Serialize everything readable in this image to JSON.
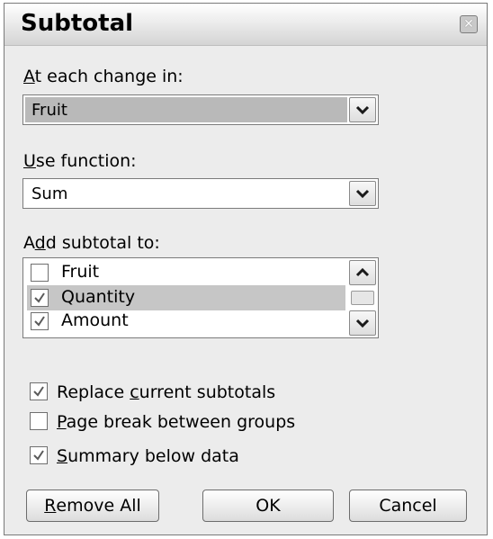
{
  "dialog": {
    "title": "Subtotal",
    "close_icon": "close-icon"
  },
  "at_each_change": {
    "label_hotkey": "A",
    "label_rest": "t each change in:",
    "value": "Fruit"
  },
  "use_function": {
    "label_hotkey": "U",
    "label_rest": "se function:",
    "value": "Sum"
  },
  "add_subtotal": {
    "label_pre": "A",
    "label_hotkey": "d",
    "label_rest": "d subtotal to:",
    "items": [
      {
        "label": "Fruit",
        "checked": false
      },
      {
        "label": "Quantity",
        "checked": true
      },
      {
        "label": "Amount",
        "checked": true
      }
    ]
  },
  "options": {
    "replace": {
      "pre": "Replace ",
      "hotkey": "c",
      "rest": "urrent subtotals",
      "checked": true
    },
    "page_break": {
      "pre": "",
      "hotkey": "P",
      "rest": "age break between groups",
      "checked": false
    },
    "summary": {
      "pre": "",
      "hotkey": "S",
      "rest": "ummary below data",
      "checked": true
    }
  },
  "buttons": {
    "remove_hotkey": "R",
    "remove_rest": "emove All",
    "ok": "OK",
    "cancel": "Cancel"
  }
}
